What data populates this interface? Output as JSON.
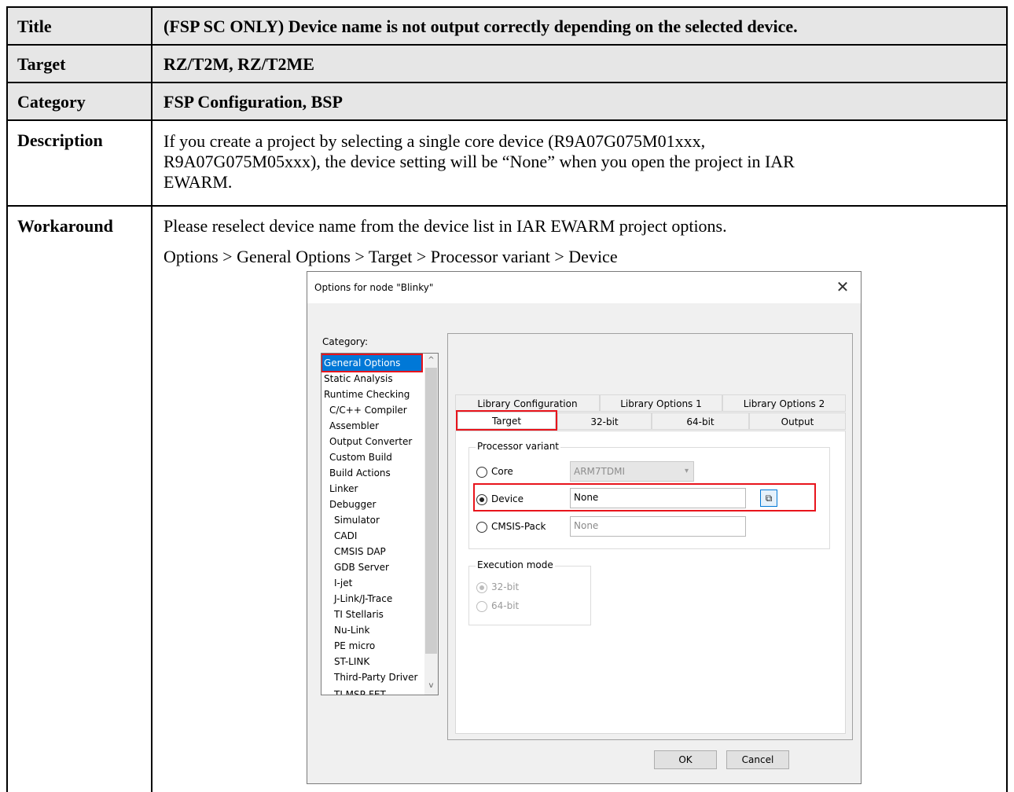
{
  "table": {
    "rows": [
      {
        "label": "Title",
        "value": "(FSP SC ONLY) Device name is not output correctly depending on the selected device."
      },
      {
        "label": "Target",
        "value": "RZ/T2M, RZ/T2ME"
      },
      {
        "label": "Category",
        "value": "FSP Configuration, BSP"
      },
      {
        "label": "Description",
        "lines": [
          "If you create a project by selecting a single core device (R9A07G075M01xxx,",
          "R9A07G075M05xxx), the device setting will be “None” when you open the project in IAR",
          "EWARM."
        ]
      },
      {
        "label": "Workaround",
        "lines": [
          "Please reselect device name from the device list in IAR EWARM project options.",
          "Options > General Options > Target > Processor variant > Device"
        ]
      }
    ]
  },
  "dialog": {
    "title": "Options for node \"Blinky\"",
    "close_glyph": "✕",
    "category_label": "Category:",
    "categories": [
      "General Options",
      "Static Analysis",
      "Runtime Checking",
      "C/C++ Compiler",
      "Assembler",
      "Output Converter",
      "Custom Build",
      "Build Actions",
      "Linker",
      "Debugger",
      "Simulator",
      "CADI",
      "CMSIS DAP",
      "GDB Server",
      "I-jet",
      "J-Link/J-Trace",
      "TI Stellaris",
      "Nu-Link",
      "PE micro",
      "ST-LINK",
      "Third-Party Driver",
      "TI MSP-FET"
    ],
    "selected_category": "General Options",
    "tabs_top": [
      "Library Configuration",
      "Library Options 1",
      "Library Options 2"
    ],
    "tabs_bottom": [
      "Target",
      "32-bit",
      "64-bit",
      "Output"
    ],
    "active_tab": "Target",
    "processor_variant": {
      "title": "Processor variant",
      "core_label": "Core",
      "core_value": "ARM7TDMI",
      "device_label": "Device",
      "device_value": "None",
      "cmsis_label": "CMSIS-Pack",
      "cmsis_value": "None",
      "selected": "Device"
    },
    "execution_mode": {
      "title": "Execution mode",
      "options": [
        "32-bit",
        "64-bit"
      ],
      "selected": "32-bit"
    },
    "buttons": {
      "ok": "OK",
      "cancel": "Cancel"
    },
    "highlight_color": "#e8141c",
    "selection_color": "#0078d7"
  }
}
